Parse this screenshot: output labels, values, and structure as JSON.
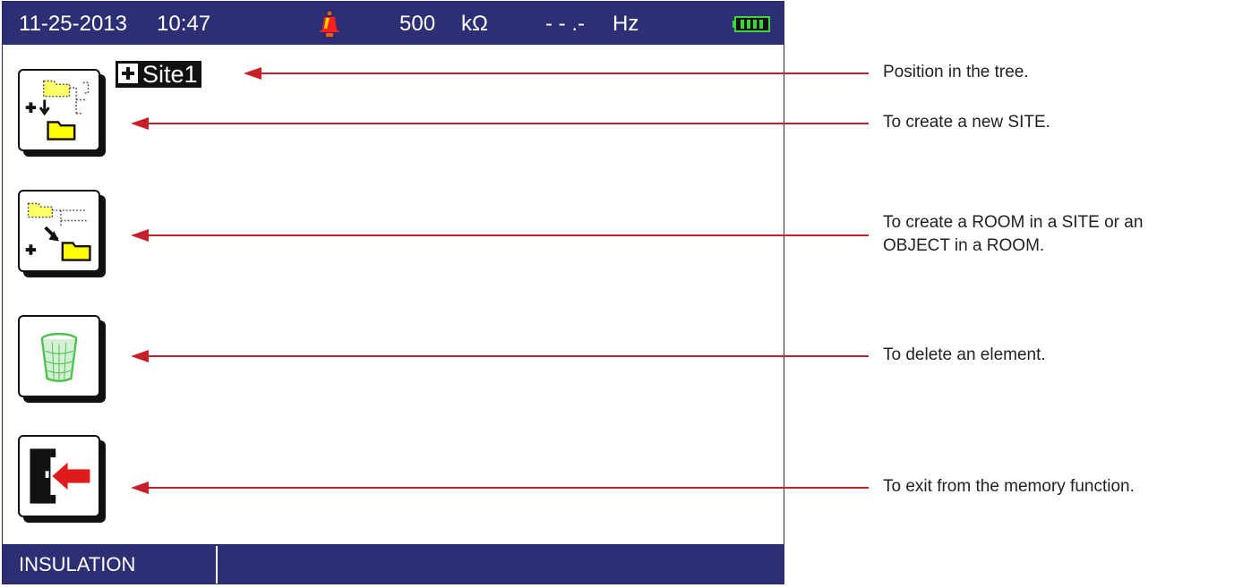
{
  "status_bar": {
    "date": "11-25-2013",
    "time": "10:47",
    "alarm_icon": "bell-icon",
    "voltage_value": "500",
    "voltage_unit": "kΩ",
    "frequency_value": "- - .-",
    "frequency_unit": "Hz",
    "battery_icon": "battery-icon"
  },
  "tree": {
    "position_label": "Site1"
  },
  "buttons": [
    {
      "name": "create-site-button",
      "icon": "new-site-icon"
    },
    {
      "name": "create-room-object-button",
      "icon": "new-child-icon"
    },
    {
      "name": "delete-element-button",
      "icon": "trash-icon"
    },
    {
      "name": "exit-memory-button",
      "icon": "exit-door-icon"
    }
  ],
  "annotations": {
    "position": "Position in the tree.",
    "create_site": "To create a new SITE.",
    "create_room_line1": "To create a ROOM in a SITE or an",
    "create_room_line2": "OBJECT in a ROOM.",
    "delete": "To delete an element.",
    "exit": "To exit from the memory function."
  },
  "footer": {
    "mode": "INSULATION"
  },
  "colors": {
    "bar": "#2e2e74",
    "arrow": "#c8202a",
    "folder": "#ffff00",
    "trash": "#4cc24c",
    "exit_arrow": "#e01b1b"
  }
}
